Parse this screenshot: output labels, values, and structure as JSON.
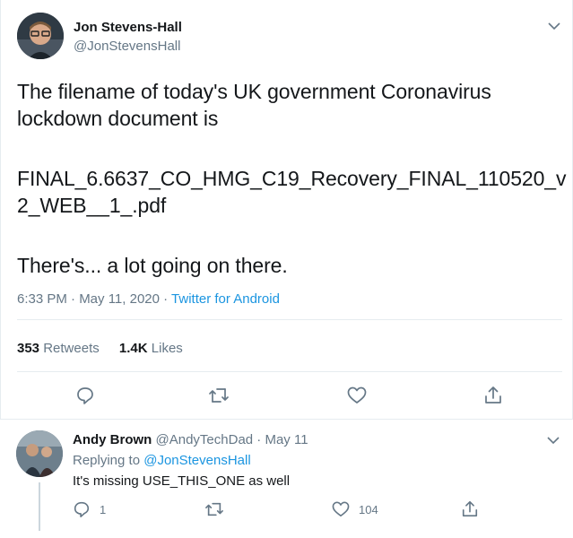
{
  "tweet": {
    "author_name": "Jon Stevens-Hall",
    "author_handle": "@JonStevensHall",
    "text_line1": "The filename of today's UK government Coronavirus",
    "text_line2": "lockdown document is",
    "text_line3": "FINAL_6.6637_CO_HMG_C19_Recovery_FINAL_110520_v",
    "text_line4": "2_WEB__1_.pdf",
    "text_line5": "There's... a lot going on there.",
    "timestamp": "6:33 PM · May 11, 2020 · ",
    "source": "Twitter for Android",
    "retweets_count": "353",
    "retweets_label": "Retweets",
    "likes_count": "1.4K",
    "likes_label": "Likes"
  },
  "reply": {
    "author_name": "Andy Brown",
    "author_handle": "@AndyTechDad · May 11",
    "replying_prefix": "Replying to ",
    "replying_handle": "@JonStevensHall",
    "text": "It's missing USE_THIS_ONE as well",
    "reply_count": "1",
    "like_count": "104"
  },
  "icons": [
    "chevron-down-icon",
    "reply-icon",
    "retweet-icon",
    "like-icon",
    "share-icon"
  ],
  "colors": {
    "link": "#1b95e0",
    "muted": "#657786",
    "text": "#14171a",
    "border": "#e6ecf0"
  }
}
